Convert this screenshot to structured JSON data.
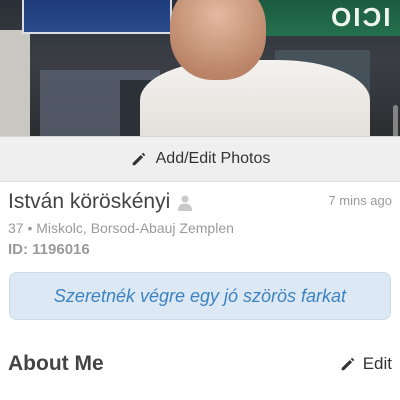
{
  "photo": {
    "sign_text": "ICIO"
  },
  "photo_bar": {
    "label": "Add/Edit Photos",
    "icon": "pencil-icon"
  },
  "profile": {
    "name": "István köröskényi",
    "time_ago": "7 mins ago",
    "location": "37 • Miskolc, Borsod-Abauj Zemplen",
    "id_line": "ID: 1196016"
  },
  "headline": "Szeretnék végre egy jó szörös farkat",
  "about": {
    "title": "About Me",
    "edit_label": "Edit"
  }
}
